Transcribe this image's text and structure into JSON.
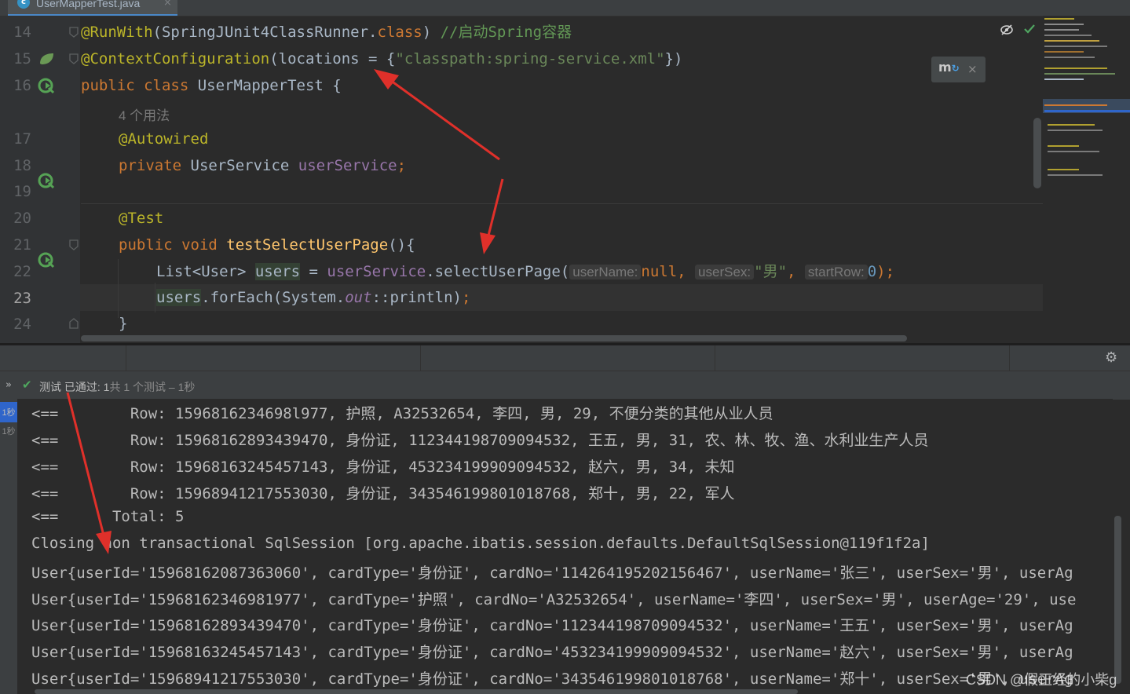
{
  "tab": {
    "label": "UserMapperTest.java",
    "icon": "java-class-icon",
    "close": "×"
  },
  "editor": {
    "line_numbers": [
      "14",
      "15",
      "16",
      "17",
      "18",
      "19",
      "20",
      "21",
      "22",
      "23",
      "24"
    ],
    "current_line": "23",
    "usages": "4 个用法",
    "code": {
      "l14_annotation": "@RunWith",
      "l14_args": "(SpringJUnit4ClassRunner.",
      "l14_class_kw": "class",
      "l14_close": ")",
      "l14_comment": " //启动Spring容器",
      "l15_annotation": "@ContextConfiguration",
      "l15_args": "(locations = {",
      "l15_string": "\"classpath:spring-service.xml\"",
      "l15_close": "})",
      "l16_kw": "public class ",
      "l16_name": "UserMapperTest {",
      "l17_annotation": "@Autowired",
      "l18_kw": "private ",
      "l18_type": "UserService ",
      "l18_field": "userService",
      "l18_semi": ";",
      "l20_annotation": "@Test",
      "l21_kw": "public void ",
      "l21_method": "testSelectUserPage",
      "l21_rest": "(){",
      "l22_decl": "List<User> ",
      "l22_var": "users",
      "l22_assign": " = ",
      "l22_field": "userService",
      "l22_call": ".selectUserPage(",
      "l22_hint1": "userName:",
      "l22_null": "null",
      "l22_comma1": ", ",
      "l22_hint2": "userSex:",
      "l22_str": "\"男\"",
      "l22_comma2": ", ",
      "l22_hint3": "startRow:",
      "l22_zero": "0",
      "l22_close": ");",
      "l23_var": "users",
      "l23_call": ".forEach(System.",
      "l23_out": "out",
      "l23_ref": "::println)",
      "l23_semi": ";",
      "l24_brace": "}"
    },
    "icons": {
      "eye": "eye-slash-icon",
      "check": "check-icon",
      "popup": "maven-reload-icon"
    }
  },
  "status": {
    "icon": "check-icon",
    "label": "测试 已通过:",
    "count": " 1",
    "summary": "共 1 个测试 – 1秒"
  },
  "side_times": [
    "1秒",
    "1秒"
  ],
  "console": [
    "<==        Row: 1596816234698l977, 护照, A32532654, 李四, 男, 29, 不便分类的其他从业人员",
    "<==        Row: 15968162893439470, 身份证, 112344198709094532, 王五, 男, 31, 农、林、牧、渔、水利业生产人员",
    "<==        Row: 15968163245457143, 身份证, 453234199909094532, 赵六, 男, 34, 未知",
    "<==        Row: 15968941217553030, 身份证, 343546199801018768, 郑十, 男, 22, 军人",
    "<==      Total: 5",
    "Closing non transactional SqlSession [org.apache.ibatis.session.defaults.DefaultSqlSession@119f1f2a]",
    "User{userId='15968162087363060', cardType='身份证', cardNo='114264195202156467', userName='张三', userSex='男', userAg",
    "User{userId='15968162346981977', cardType='护照', cardNo='A32532654', userName='李四', userSex='男', userAge='29', use",
    "User{userId='15968162893439470', cardType='身份证', cardNo='112344198709094532', userName='王五', userSex='男', userAg",
    "User{userId='15968163245457143', cardType='身份证', cardNo='453234199909094532', userName='赵六', userSex='男', userAg",
    "User{userId='15968941217553030', cardType='身份证', cardNo='343546199801018768', userName='郑十', userSex='男', userAg"
  ],
  "watermark": "CSDN @假正经的小柴g",
  "colors": {
    "annotation": "#bbb529",
    "keyword": "#cc7832",
    "string": "#6a8759",
    "field": "#9876aa",
    "method": "#ffc66d",
    "arrow": "#e0302a",
    "pass": "#4fa95f"
  }
}
